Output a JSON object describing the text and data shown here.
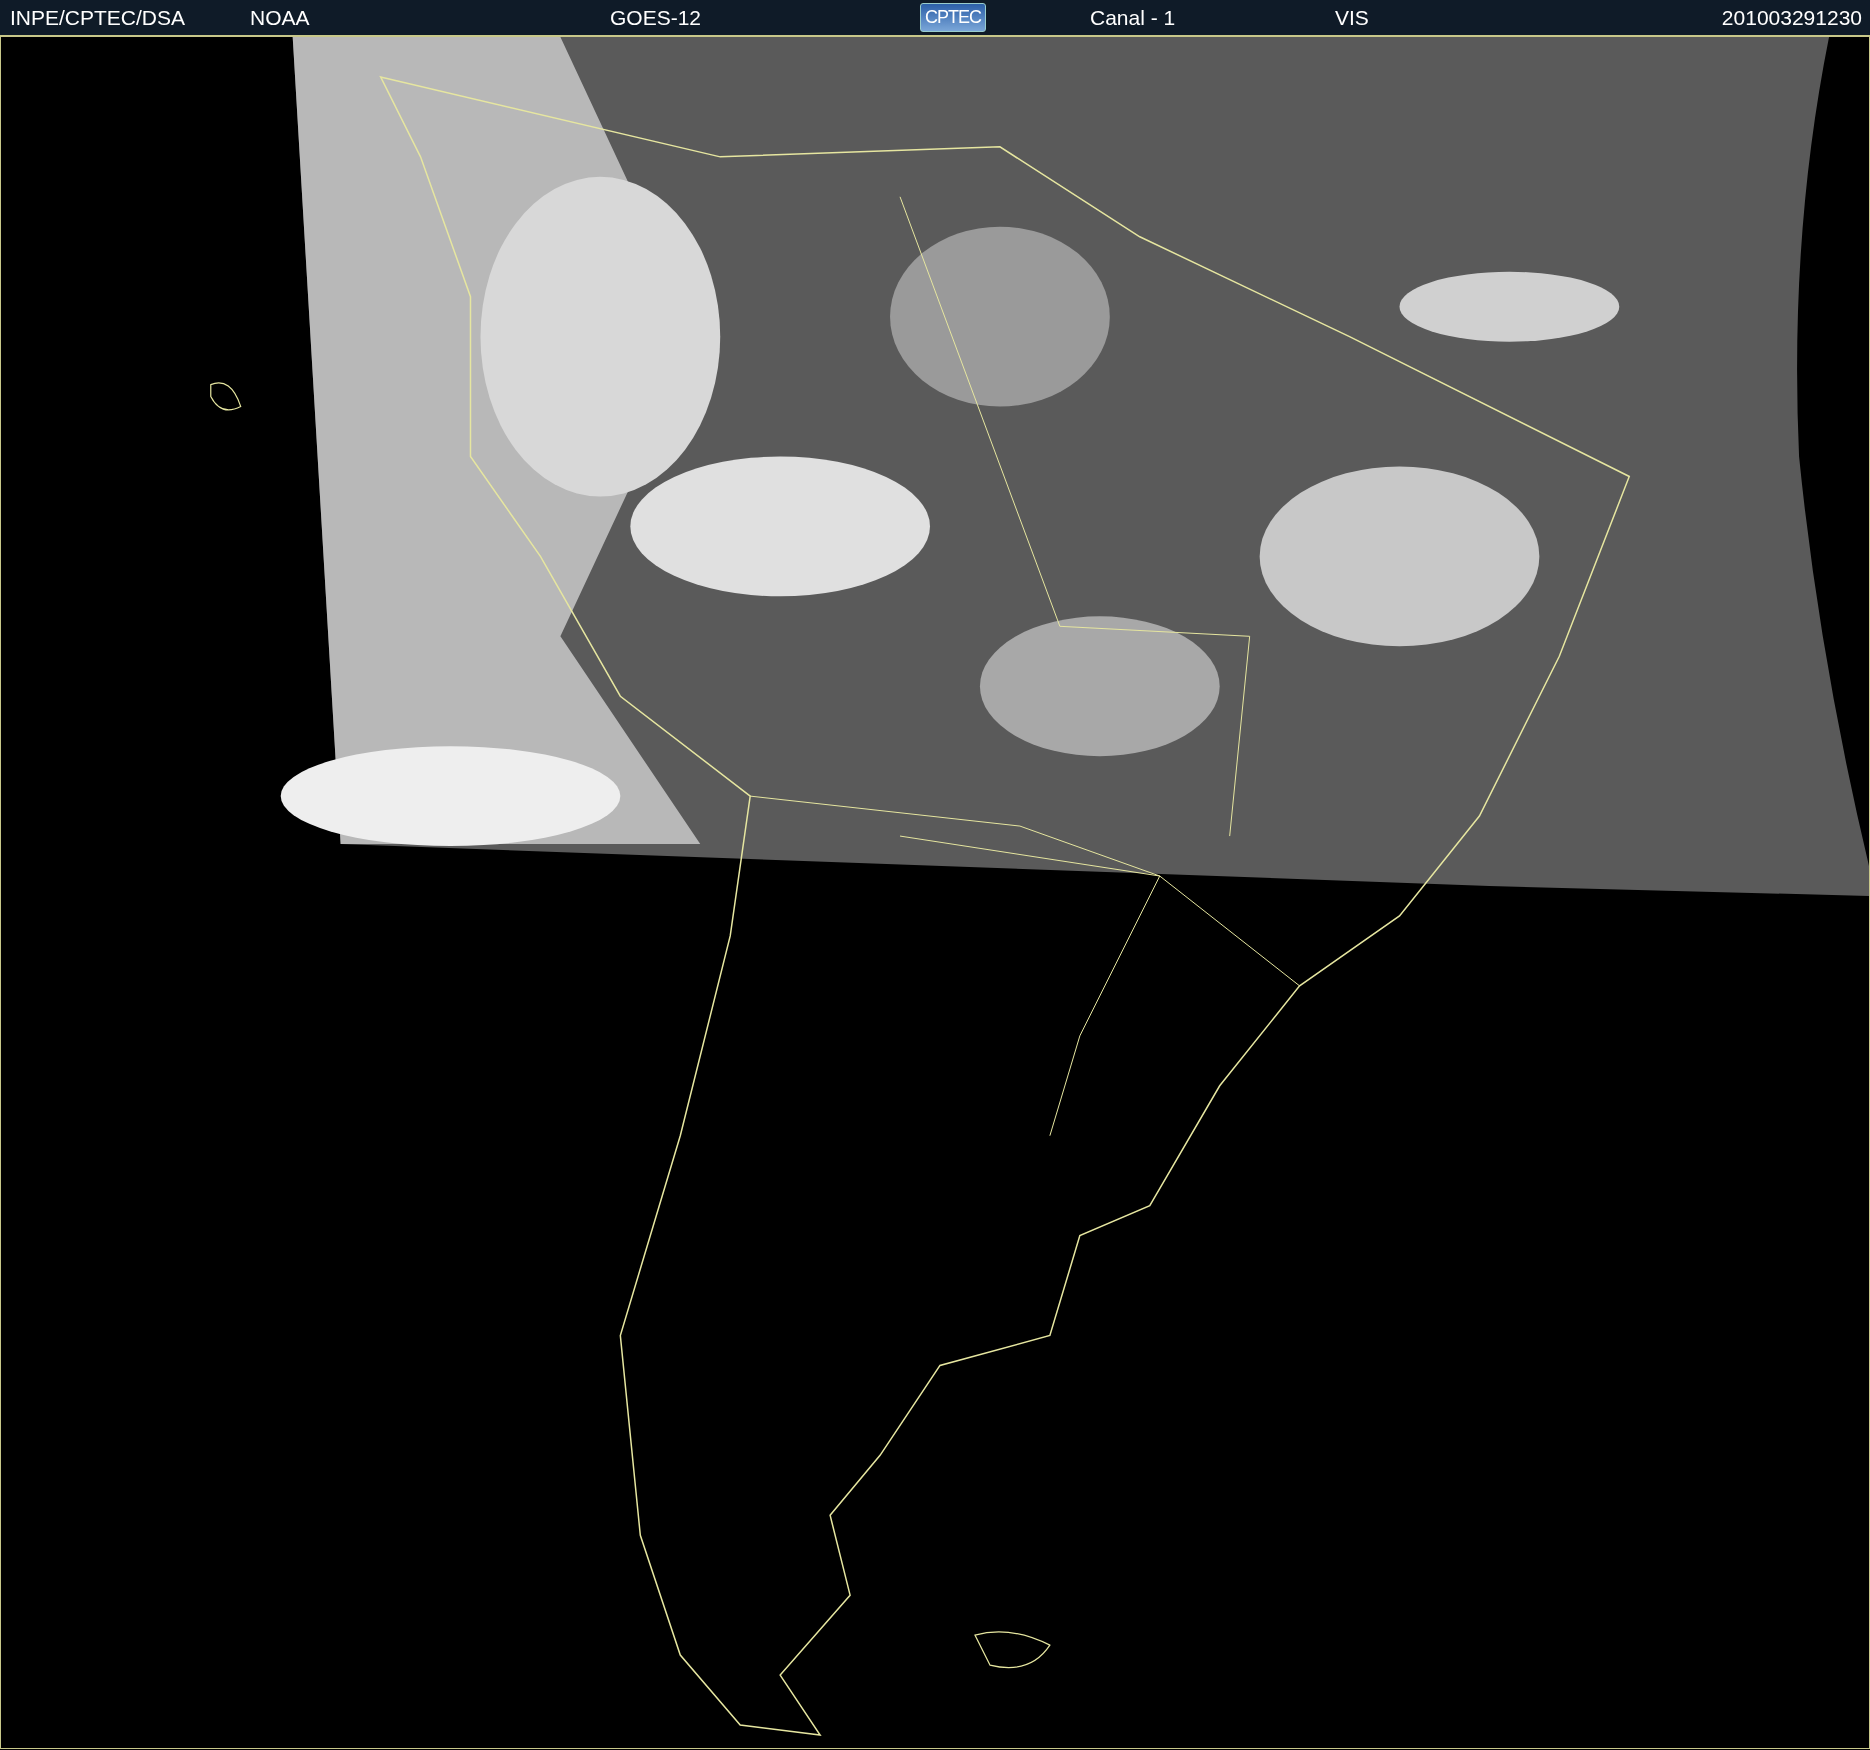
{
  "header": {
    "items": [
      {
        "kind": "text",
        "text": "INPE/CPTEC/DSA"
      },
      {
        "kind": "text",
        "text": "NOAA"
      },
      {
        "kind": "text",
        "text": "GOES-12"
      },
      {
        "kind": "logo",
        "text": "CPTEC"
      },
      {
        "kind": "text",
        "text": "Canal - 1"
      },
      {
        "kind": "text",
        "text": "VIS"
      },
      {
        "kind": "text",
        "text": "201003291230"
      }
    ]
  }
}
